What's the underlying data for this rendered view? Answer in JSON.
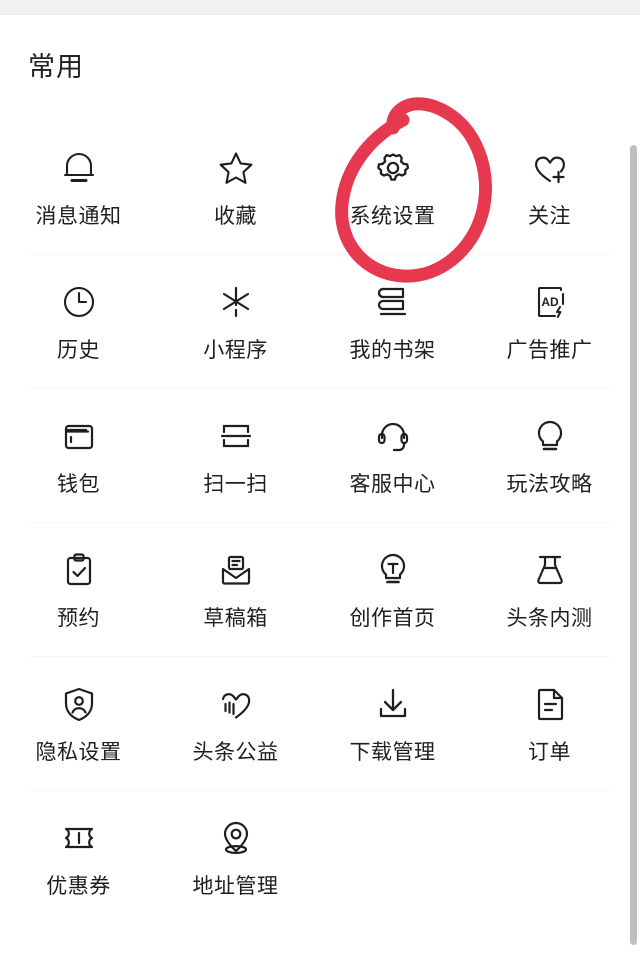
{
  "page": {
    "section_title": "常用",
    "accent_color": "#e63950",
    "icon_color": "#1f1f1f",
    "background": "#ffffff"
  },
  "annotation": {
    "type": "hand-drawn-ellipse",
    "color": "#e63950",
    "targets": "系统设置"
  },
  "scrollbar": {
    "orientation": "vertical",
    "color": "#bfbfbf"
  },
  "grid": {
    "columns": 4,
    "rows": [
      [
        {
          "label": "消息通知",
          "icon": "bell-icon"
        },
        {
          "label": "收藏",
          "icon": "star-icon"
        },
        {
          "label": "系统设置",
          "icon": "gear-icon"
        },
        {
          "label": "关注",
          "icon": "heart-plus-icon"
        }
      ],
      [
        {
          "label": "历史",
          "icon": "clock-icon"
        },
        {
          "label": "小程序",
          "icon": "miniprogram-icon"
        },
        {
          "label": "我的书架",
          "icon": "bookshelf-icon"
        },
        {
          "label": "广告推广",
          "icon": "ad-icon"
        }
      ],
      [
        {
          "label": "钱包",
          "icon": "wallet-icon"
        },
        {
          "label": "扫一扫",
          "icon": "scan-icon"
        },
        {
          "label": "客服中心",
          "icon": "headset-icon"
        },
        {
          "label": "玩法攻略",
          "icon": "lightbulb-icon"
        }
      ],
      [
        {
          "label": "预约",
          "icon": "clipboard-check-icon"
        },
        {
          "label": "草稿箱",
          "icon": "draft-envelope-icon"
        },
        {
          "label": "创作首页",
          "icon": "idea-bulb-icon"
        },
        {
          "label": "头条内测",
          "icon": "flask-icon"
        }
      ],
      [
        {
          "label": "隐私设置",
          "icon": "shield-user-icon"
        },
        {
          "label": "头条公益",
          "icon": "charity-heart-icon"
        },
        {
          "label": "下载管理",
          "icon": "download-icon"
        },
        {
          "label": "订单",
          "icon": "document-lines-icon"
        }
      ],
      [
        {
          "label": "优惠券",
          "icon": "coupon-icon"
        },
        {
          "label": "地址管理",
          "icon": "location-pin-icon"
        },
        {
          "label": "",
          "icon": ""
        },
        {
          "label": "",
          "icon": ""
        }
      ]
    ]
  }
}
